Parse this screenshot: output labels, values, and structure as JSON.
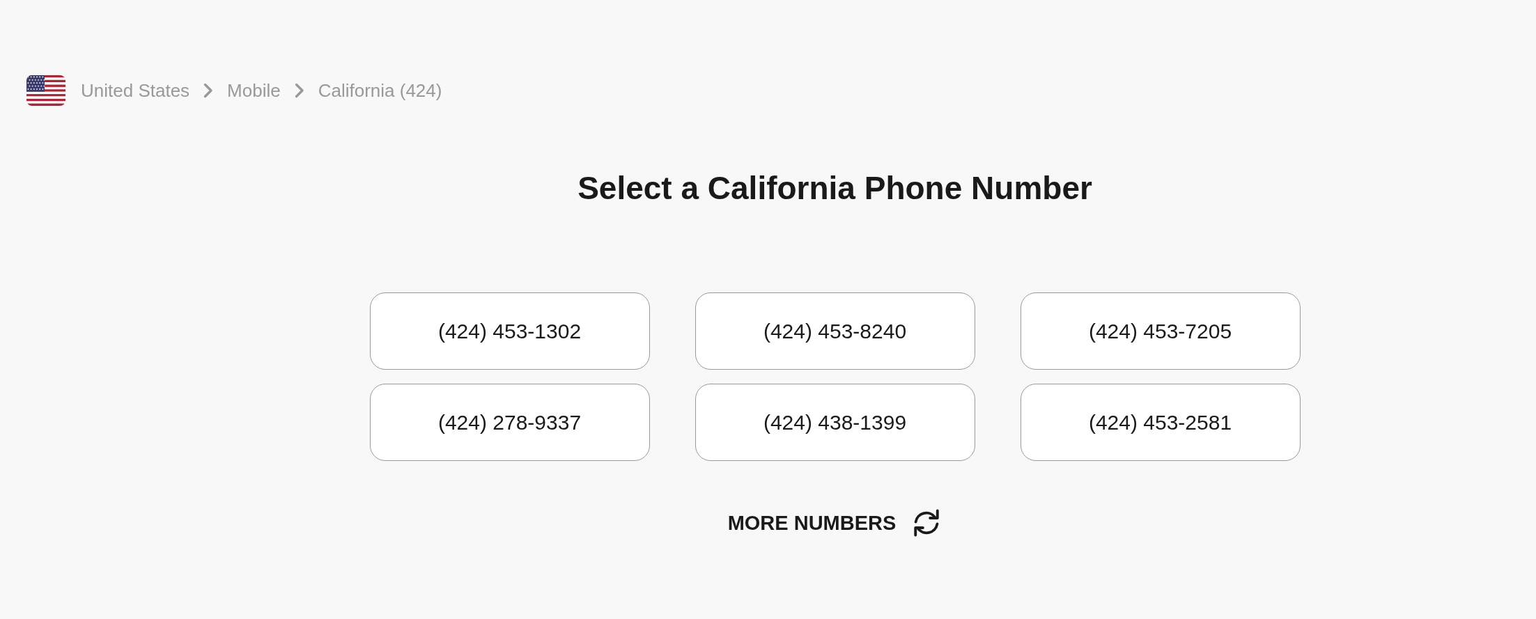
{
  "breadcrumb": [
    {
      "label": "United States"
    },
    {
      "label": "Mobile"
    },
    {
      "label": "California (424)"
    }
  ],
  "heading": "Select a California Phone Number",
  "numbers": [
    "(424) 453-1302",
    "(424) 453-8240",
    "(424) 453-7205",
    "(424) 278-9337",
    "(424) 438-1399",
    "(424) 453-2581"
  ],
  "more_button": {
    "label": "MORE NUMBERS"
  }
}
